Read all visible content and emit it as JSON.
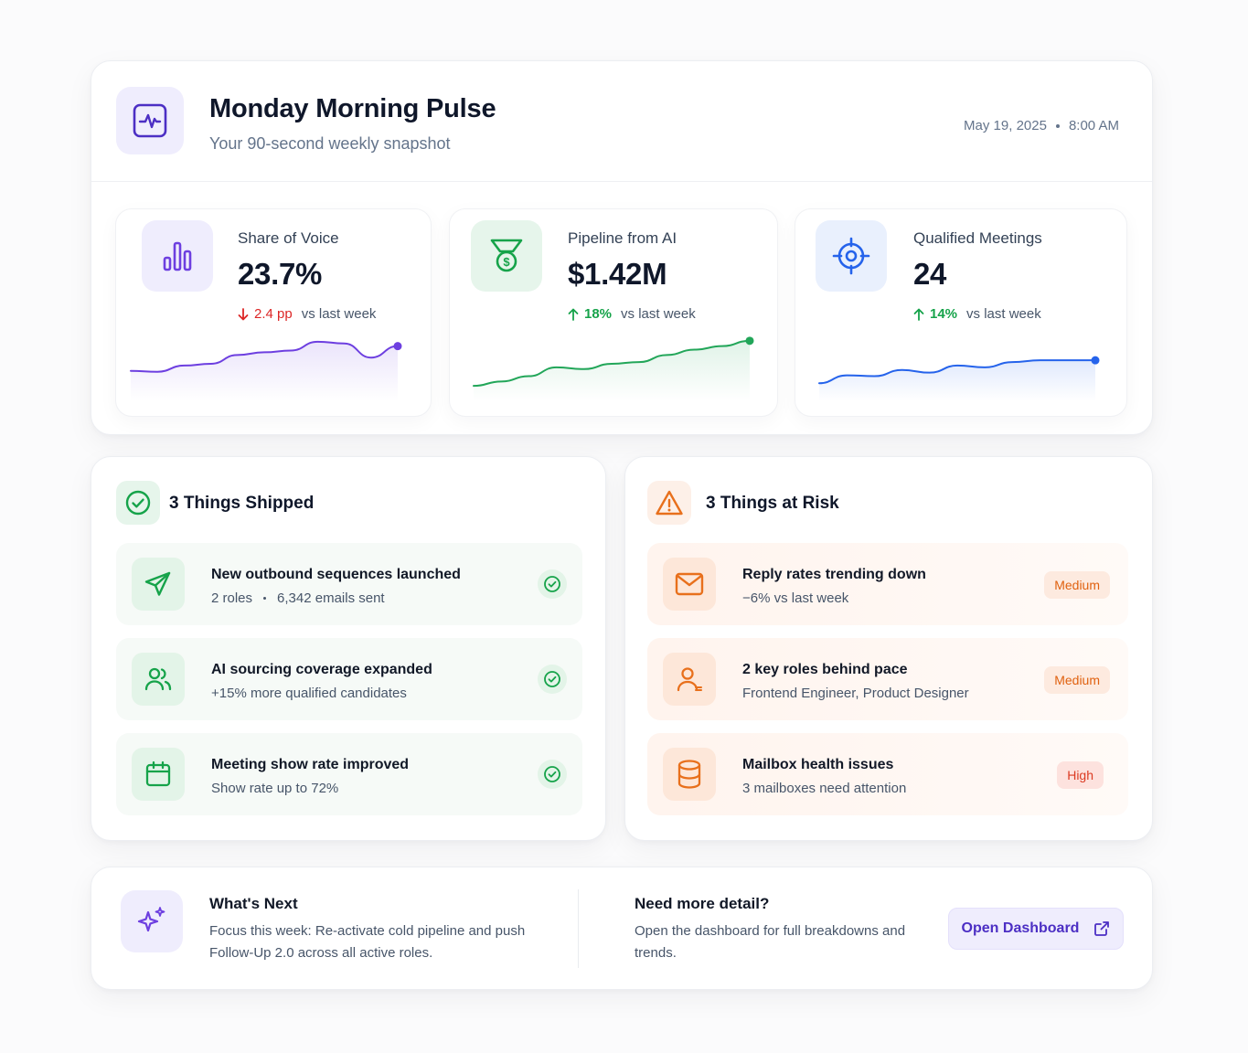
{
  "header": {
    "title": "Monday Morning Pulse",
    "subtitle": "Your 90-second weekly snapshot",
    "date": "May 19, 2025",
    "time": "8:00 AM",
    "icon": "pulse-icon"
  },
  "metrics": [
    {
      "label": "Share of Voice",
      "value": "23.7%",
      "change": "2.4 pp",
      "direction": "down",
      "comparison": "vs last week",
      "icon": "bar-chart-icon",
      "color": "#6d3fe0",
      "icon_bg": "#efedfd",
      "trend": [
        2.2,
        2.1,
        2.8,
        3.0,
        4.0,
        4.3,
        4.5,
        5.5,
        5.3,
        3.7,
        5.0
      ]
    },
    {
      "label": "Pipeline from AI",
      "value": "$1.42M",
      "change": "18%",
      "direction": "up",
      "comparison": "vs last week",
      "icon": "medal-dollar-icon",
      "color": "#22a659",
      "icon_bg": "#e6f5eb",
      "trend": [
        0.5,
        1.0,
        1.6,
        2.6,
        2.4,
        3.0,
        3.2,
        4.0,
        4.6,
        5.0,
        5.6
      ]
    },
    {
      "label": "Qualified Meetings",
      "value": "24",
      "change": "14%",
      "direction": "up",
      "comparison": "vs last week",
      "icon": "target-icon",
      "color": "#2563eb",
      "icon_bg": "#e9f0fd",
      "trend": [
        0.8,
        1.7,
        1.6,
        2.3,
        2.0,
        2.8,
        2.6,
        3.2,
        3.4,
        3.4,
        3.4
      ]
    }
  ],
  "shipped": {
    "title": "3 Things Shipped",
    "items": [
      {
        "title": "New outbound sequences launched",
        "sub_a": "2 roles",
        "sub_b": "6,342 emails sent",
        "icon": "send-icon"
      },
      {
        "title": "AI sourcing coverage expanded",
        "sub": "+15% more qualified candidates",
        "icon": "users-icon"
      },
      {
        "title": "Meeting show rate improved",
        "sub": "Show rate up to 72%",
        "icon": "calendar-icon"
      }
    ]
  },
  "risks": {
    "title": "3 Things at Risk",
    "items": [
      {
        "title": "Reply rates trending down",
        "sub": "−6% vs last week",
        "badge": "Medium",
        "icon": "mail-icon"
      },
      {
        "title": "2 key roles behind pace",
        "sub": "Frontend Engineer, Product Designer",
        "badge": "Medium",
        "icon": "user-icon"
      },
      {
        "title": "Mailbox health issues",
        "sub": "3 mailboxes need attention",
        "badge": "High",
        "icon": "database-icon"
      }
    ]
  },
  "next": {
    "title": "What's Next",
    "text": "Focus this week: Re-activate cold pipeline and push Follow-Up 2.0 across all active roles.",
    "detail_title": "Need more detail?",
    "detail_text": "Open the dashboard for full breakdowns and trends.",
    "button": "Open Dashboard",
    "icon": "sparkles-icon"
  },
  "colors": {
    "purple": "#6d3fe0",
    "green": "#22a659",
    "blue": "#2563eb",
    "orange": "#e8701c",
    "red": "#dc2626"
  }
}
